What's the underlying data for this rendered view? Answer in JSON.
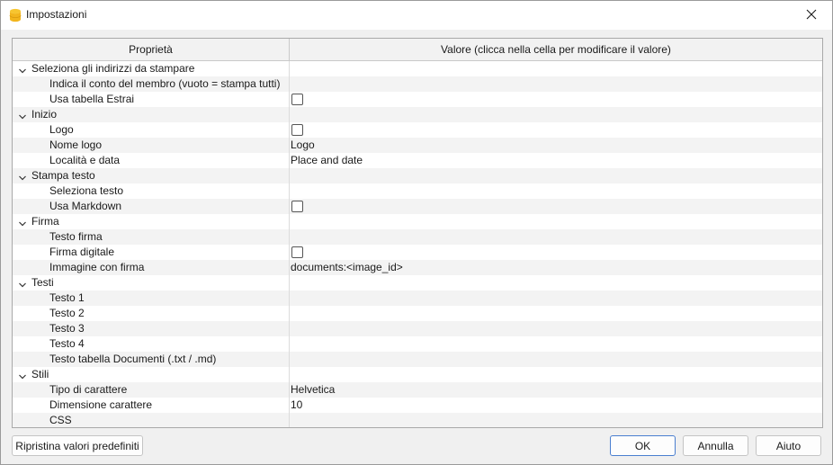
{
  "window": {
    "title": "Impostazioni"
  },
  "table": {
    "headers": {
      "property": "Proprietà",
      "value": "Valore (clicca nella cella per modificare il valore)"
    },
    "rows": [
      {
        "kind": "group",
        "label": "Seleziona gli indirizzi da stampare",
        "value": ""
      },
      {
        "kind": "child",
        "label": "Indica il conto del membro (vuoto = stampa tutti)",
        "value": ""
      },
      {
        "kind": "child",
        "label": "Usa tabella Estrai",
        "value": "",
        "checkbox": true
      },
      {
        "kind": "group",
        "label": "Inizio",
        "value": ""
      },
      {
        "kind": "child",
        "label": "Logo",
        "value": "",
        "checkbox": true
      },
      {
        "kind": "child",
        "label": "Nome logo",
        "value": "Logo"
      },
      {
        "kind": "child",
        "label": "Località e data",
        "value": "Place and date"
      },
      {
        "kind": "group",
        "label": "Stampa testo",
        "value": ""
      },
      {
        "kind": "child",
        "label": "Seleziona testo",
        "value": ""
      },
      {
        "kind": "child",
        "label": "Usa Markdown",
        "value": "",
        "checkbox": true
      },
      {
        "kind": "group",
        "label": "Firma",
        "value": ""
      },
      {
        "kind": "child",
        "label": "Testo firma",
        "value": ""
      },
      {
        "kind": "child",
        "label": "Firma digitale",
        "value": "",
        "checkbox": true
      },
      {
        "kind": "child",
        "label": "Immagine con firma",
        "value": "documents:<image_id>"
      },
      {
        "kind": "group",
        "label": "Testi",
        "value": ""
      },
      {
        "kind": "child",
        "label": "Testo 1",
        "value": ""
      },
      {
        "kind": "child",
        "label": "Testo 2",
        "value": ""
      },
      {
        "kind": "child",
        "label": "Testo 3",
        "value": ""
      },
      {
        "kind": "child",
        "label": "Testo 4",
        "value": ""
      },
      {
        "kind": "child",
        "label": "Testo tabella Documenti (.txt / .md)",
        "value": ""
      },
      {
        "kind": "group",
        "label": "Stili",
        "value": ""
      },
      {
        "kind": "child",
        "label": "Tipo di carattere",
        "value": "Helvetica"
      },
      {
        "kind": "child",
        "label": "Dimensione carattere",
        "value": "10"
      },
      {
        "kind": "child",
        "label": "CSS",
        "value": ""
      }
    ]
  },
  "buttons": {
    "reset": "Ripristina valori predefiniti",
    "ok": "OK",
    "cancel": "Annulla",
    "help": "Aiuto"
  },
  "icons": {
    "app": "app-logo-icon",
    "close": "close-icon",
    "chevron": "chevron-down-icon"
  },
  "colors": {
    "accent": "#4a7fd0",
    "app_icon": "#f2b51d"
  }
}
